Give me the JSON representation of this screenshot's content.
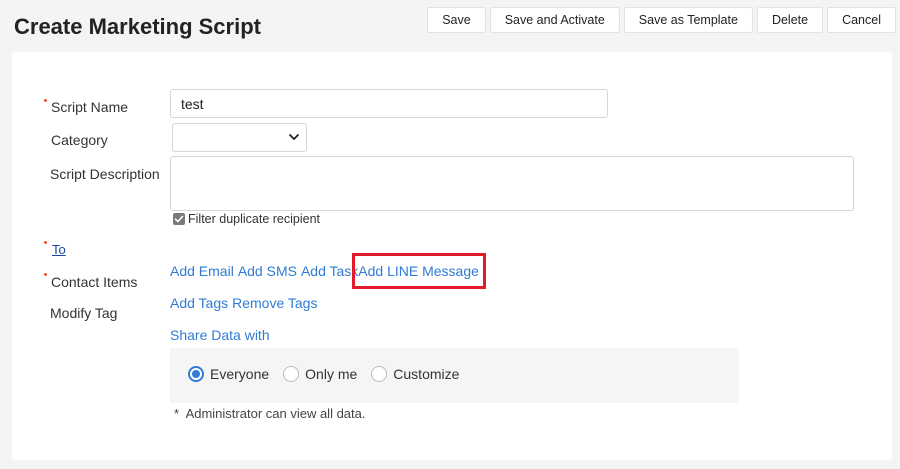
{
  "header": {
    "title": "Create Marketing Script"
  },
  "toolbar": {
    "save": "Save",
    "save_activate": "Save and Activate",
    "save_template": "Save as Template",
    "delete": "Delete",
    "cancel": "Cancel"
  },
  "form": {
    "script_name_label": "Script Name",
    "script_name_value": "test",
    "category_label": "Category",
    "category_value": "",
    "description_label": "Script Description",
    "filter_duplicate_label": "Filter duplicate recipient",
    "filter_duplicate_checked": true,
    "to_label": "To",
    "contact_items_label": "Contact Items",
    "modify_tag_label": "Modify Tag",
    "contact_actions": {
      "add_email": "Add Email",
      "add_sms": "Add SMS",
      "add_task": "Add Task",
      "add_line": "Add LINE Message"
    },
    "tag_actions": {
      "add_tags": "Add Tags",
      "remove_tags": "Remove Tags"
    },
    "share_data_label": "Share Data with",
    "share_options": {
      "everyone": "Everyone",
      "only_me": "Only me",
      "customize": "Customize",
      "selected": "everyone"
    },
    "admin_note": "*  Administrator can view all data."
  },
  "colors": {
    "link": "#2f7bd6",
    "required_marker": "#e8562a",
    "highlight": "#e11b2b"
  }
}
